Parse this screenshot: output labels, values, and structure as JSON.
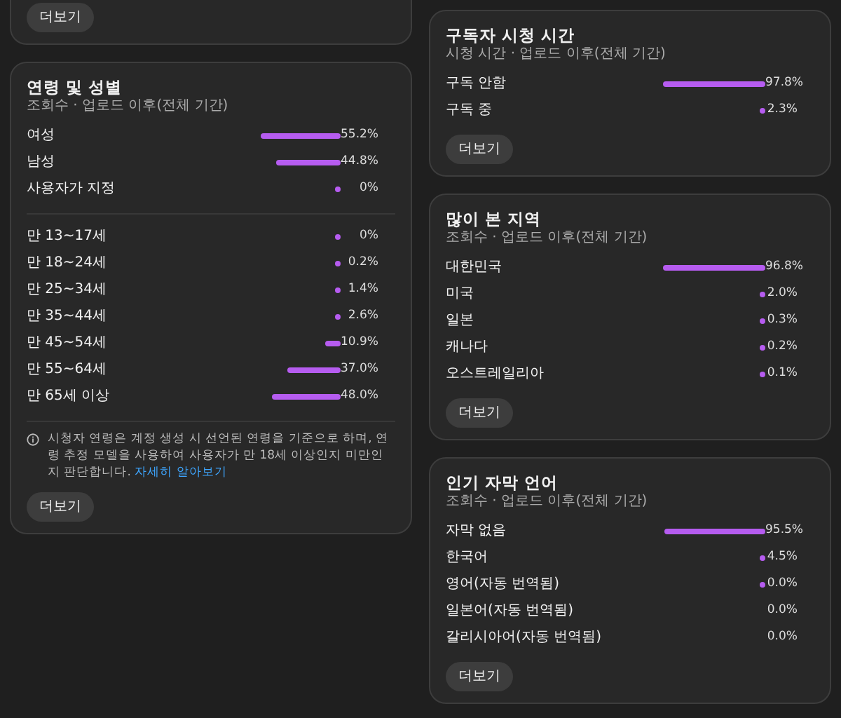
{
  "columns": [
    [
      {
        "kind": "partial",
        "more_button": "더보기"
      },
      {
        "kind": "full",
        "title": "연령 및 성별",
        "subtitle": "조회수 · 업로드 이후(전체 기간)",
        "groups": [
          [
            {
              "label": "여성",
              "bar": true,
              "value": "55.2%"
            },
            {
              "label": "남성",
              "bar": true,
              "value": "44.8%"
            },
            {
              "label": "사용자가 지정",
              "bar": true,
              "value": "0%"
            }
          ],
          [
            {
              "label": "만 13~17세",
              "bar": true,
              "value": "0%"
            },
            {
              "label": "만 18~24세",
              "bar": true,
              "value": "0.2%"
            },
            {
              "label": "만 25~34세",
              "bar": true,
              "value": "1.4%"
            },
            {
              "label": "만 35~44세",
              "bar": true,
              "value": "2.6%"
            },
            {
              "label": "만 45~54세",
              "bar": true,
              "value": "10.9%"
            },
            {
              "label": "만 55~64세",
              "bar": true,
              "value": "37.0%"
            },
            {
              "label": "만 65세 이상",
              "bar": true,
              "value": "48.0%"
            }
          ]
        ],
        "note": {
          "text": "시청자 연령은 계정 생성 시 선언된 연령을 기준으로 하며, 연령 추정 모델을 사용하여 사용자가 만 18세 이상인지 미만인지 판단합니다.",
          "link": "자세히 알아보기"
        },
        "more_button": "더보기"
      }
    ],
    [
      {
        "kind": "full",
        "title": "구독자 시청 시간",
        "subtitle": "시청 시간 · 업로드 이후(전체 기간)",
        "groups": [
          [
            {
              "label": "구독 안함",
              "bar": true,
              "value": "97.8%"
            },
            {
              "label": "구독 중",
              "bar": true,
              "value": "2.3%"
            }
          ]
        ],
        "more_button": "더보기"
      },
      {
        "kind": "full",
        "title": "많이 본 지역",
        "subtitle": "조회수 · 업로드 이후(전체 기간)",
        "groups": [
          [
            {
              "label": "대한민국",
              "bar": true,
              "value": "96.8%"
            },
            {
              "label": "미국",
              "bar": true,
              "value": "2.0%"
            },
            {
              "label": "일본",
              "bar": true,
              "value": "0.3%"
            },
            {
              "label": "캐나다",
              "bar": true,
              "value": "0.2%"
            },
            {
              "label": "오스트레일리아",
              "bar": true,
              "value": "0.1%"
            }
          ]
        ],
        "more_button": "더보기"
      },
      {
        "kind": "full",
        "title": "인기 자막 언어",
        "subtitle": "조회수 · 업로드 이후(전체 기간)",
        "groups": [
          [
            {
              "label": "자막 없음",
              "bar": true,
              "value": "95.5%"
            },
            {
              "label": "한국어",
              "bar": true,
              "value": "4.5%"
            },
            {
              "label": "영어(자동 번역됨)",
              "bar": true,
              "value": "0.0%"
            },
            {
              "label": "일본어(자동 번역됨)",
              "bar": false,
              "value": "0.0%"
            },
            {
              "label": "갈리시아어(자동 번역됨)",
              "bar": false,
              "value": "0.0%"
            }
          ]
        ],
        "more_button": "더보기"
      }
    ]
  ]
}
